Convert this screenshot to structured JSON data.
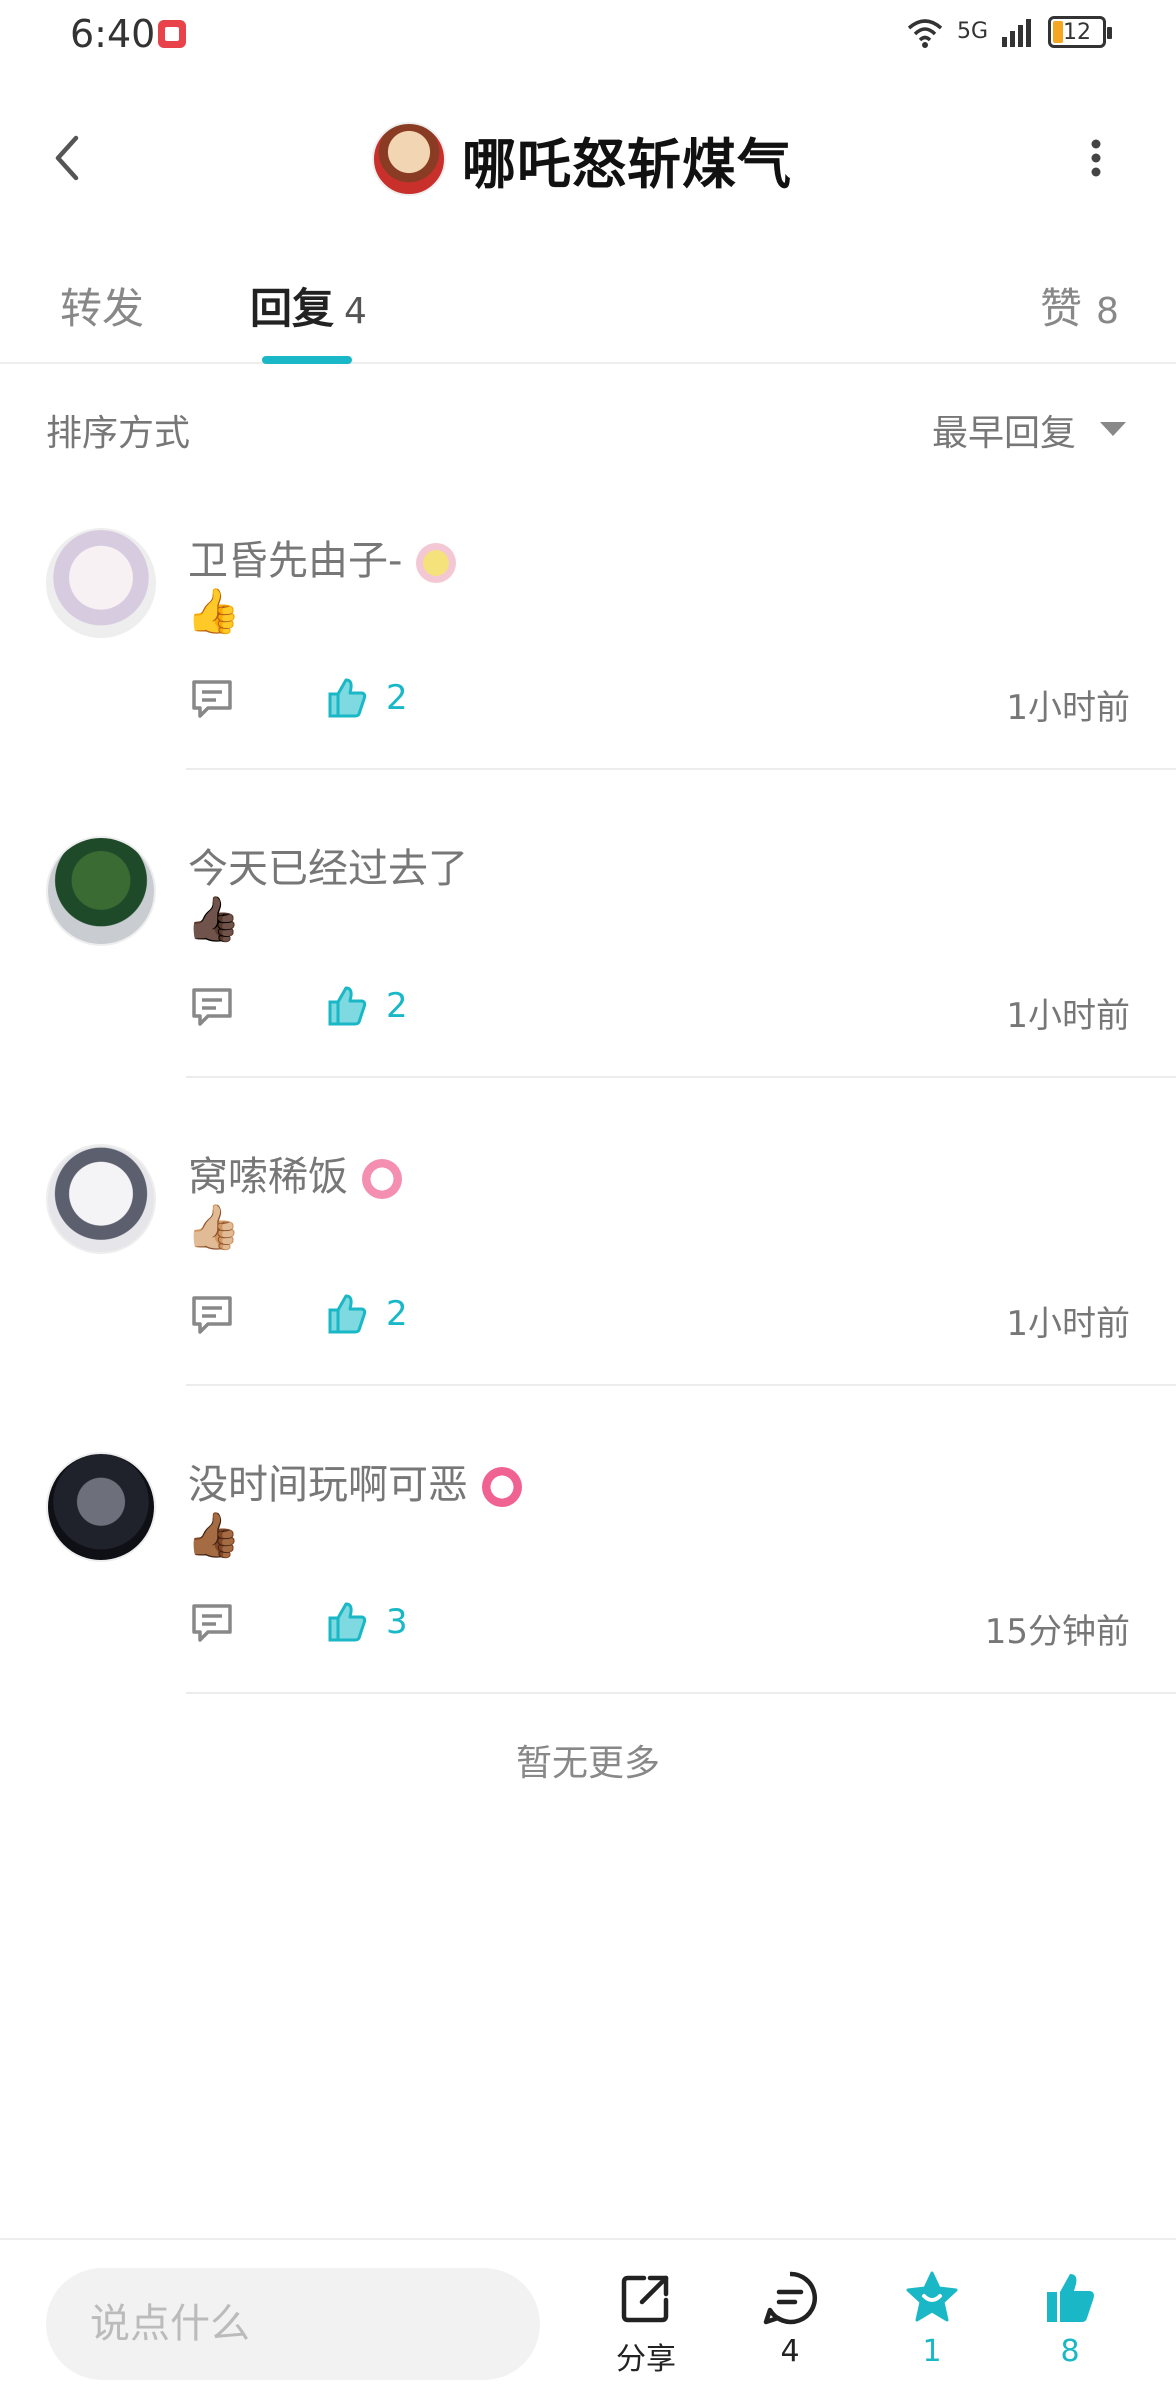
{
  "status_bar": {
    "time": "6:40",
    "network": "5G",
    "battery": "12"
  },
  "header": {
    "title": "哪吒怒斩煤气"
  },
  "tabs": {
    "repost_label": "转发",
    "reply_label": "回复",
    "reply_count": "4",
    "like_label": "赞",
    "like_count": "8"
  },
  "sort": {
    "label": "排序方式",
    "value": "最早回复"
  },
  "comments": [
    {
      "name": "卫昏先由子-",
      "emoji": "👍",
      "likes": "2",
      "time": "1小时前",
      "badge_color": "#f3c8d4"
    },
    {
      "name": "今天已经过去了",
      "emoji": "👍🏿",
      "likes": "2",
      "time": "1小时前"
    },
    {
      "name": "窝嗦稀饭",
      "emoji": "👍🏼",
      "likes": "2",
      "time": "1小时前",
      "badge_color": "#f48fb1"
    },
    {
      "name": "没时间玩啊可恶",
      "emoji": "👍🏾",
      "likes": "3",
      "time": "15分钟前",
      "badge_color": "#f06292"
    }
  ],
  "no_more": "暂无更多",
  "bottom_bar": {
    "input_placeholder": "说点什么",
    "share_label": "分享",
    "comment_count": "4",
    "fav_count": "1",
    "like_count": "8"
  },
  "colors": {
    "accent": "#1ab8c6"
  }
}
